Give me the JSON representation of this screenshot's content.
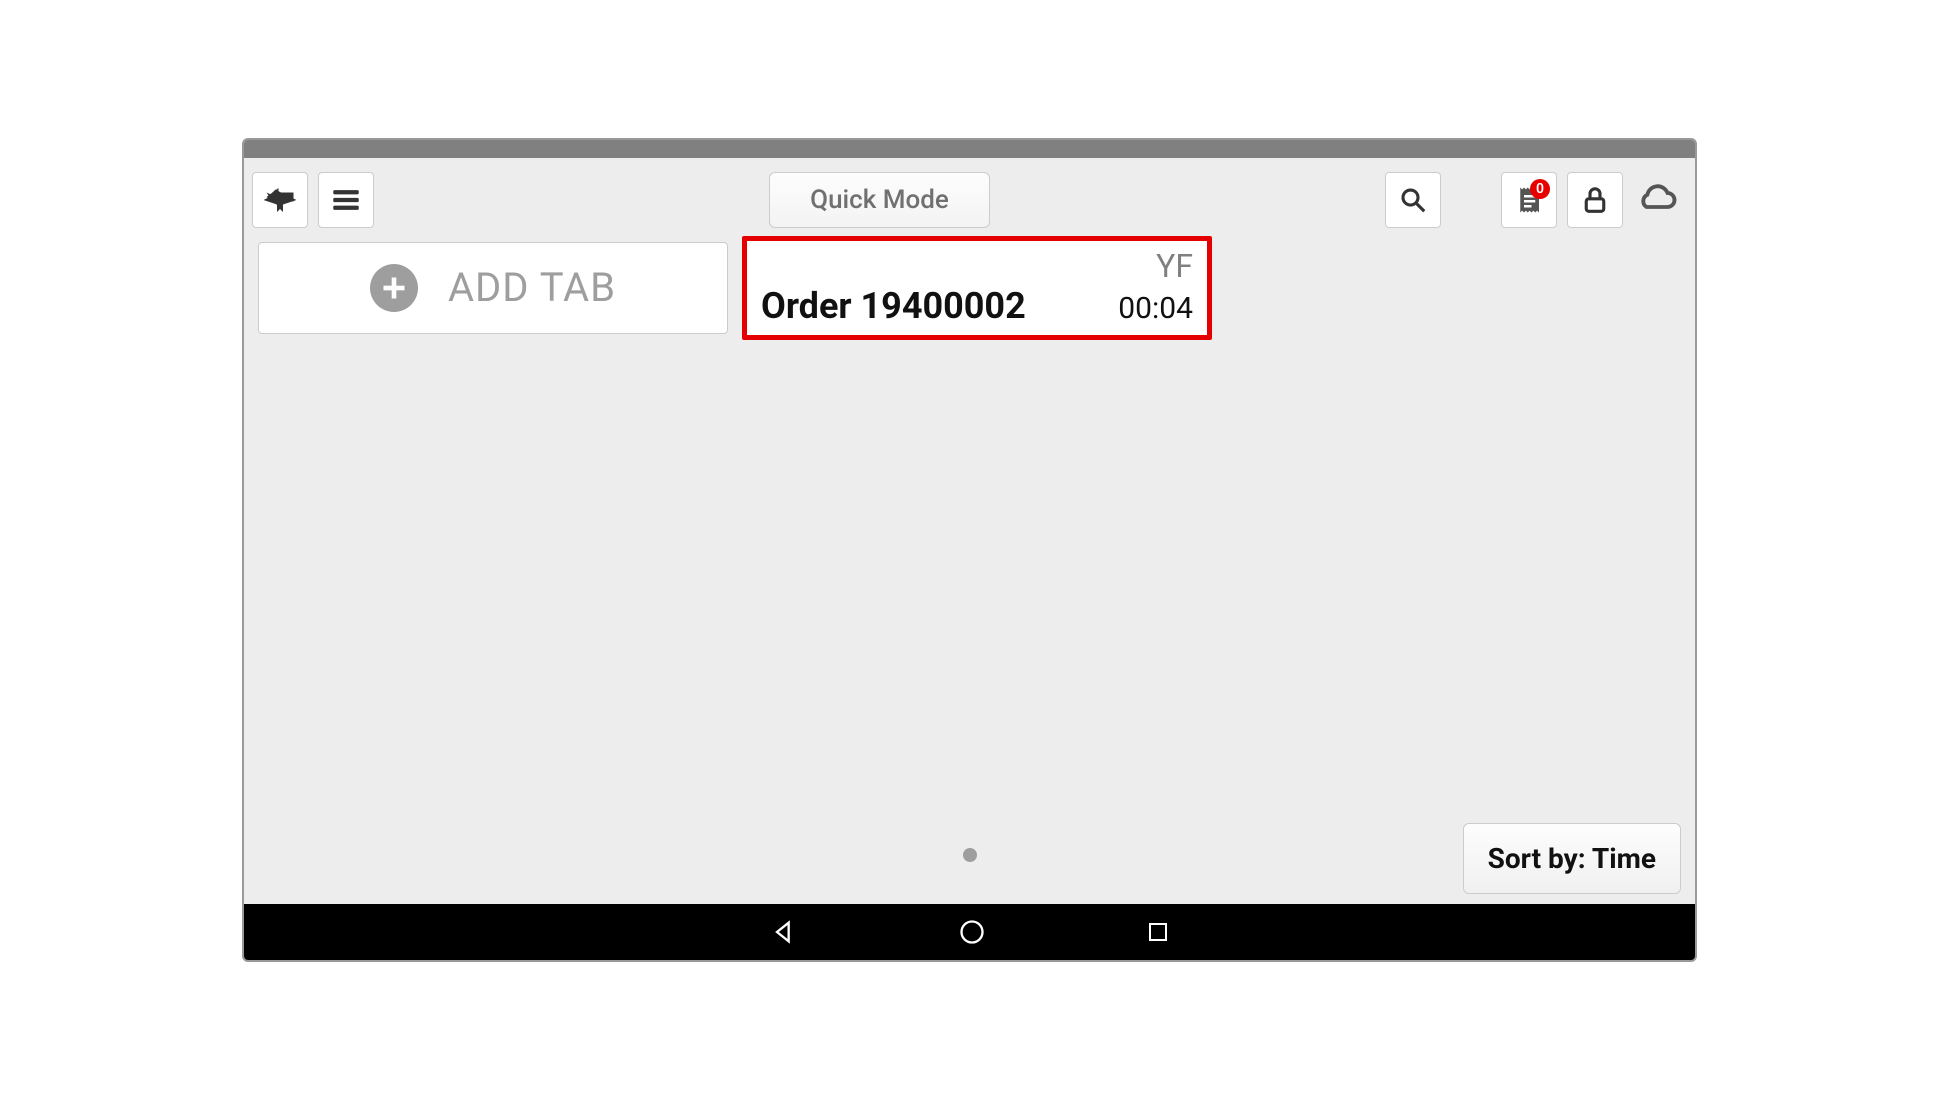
{
  "toolbar": {
    "quick_mode_label": "Quick Mode",
    "receipt_badge": "0"
  },
  "tabs": {
    "add_tab_label": "ADD TAB",
    "order": {
      "initials": "YF",
      "title": "Order 19400002",
      "elapsed": "00:04"
    }
  },
  "footer": {
    "sort_label": "Sort by: Time"
  }
}
